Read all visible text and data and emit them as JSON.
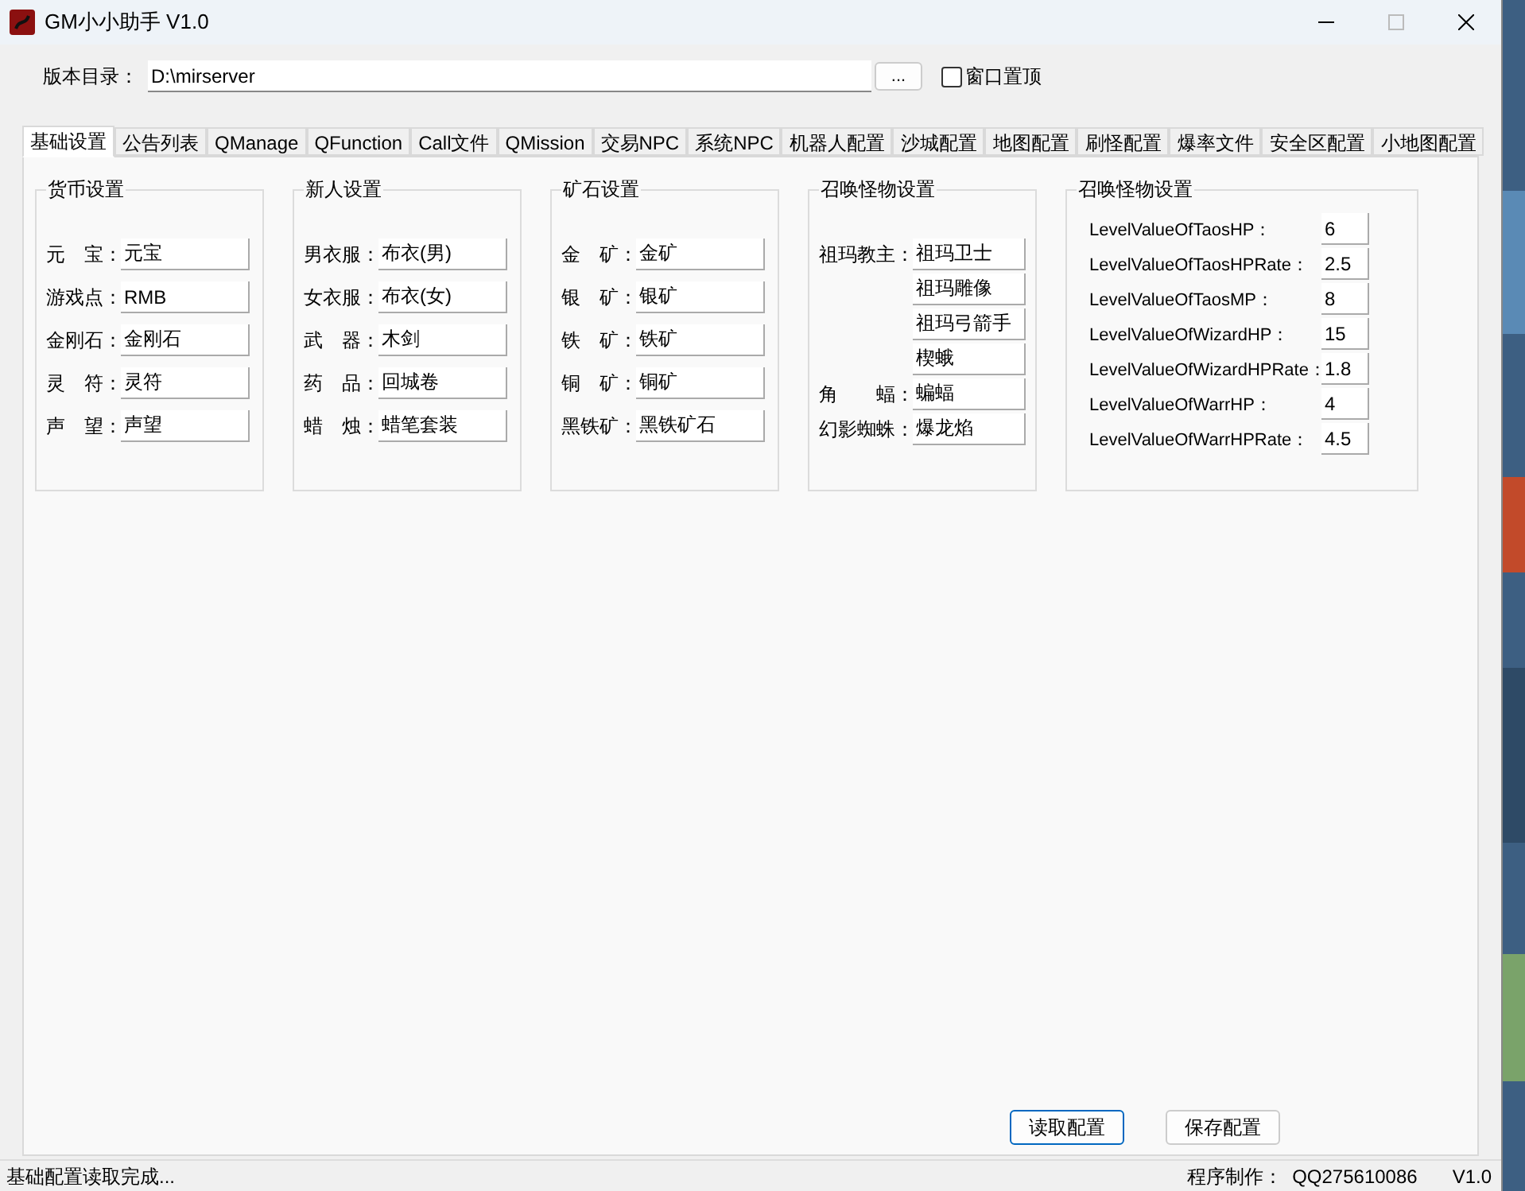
{
  "window": {
    "title": "GM小小助手 V1.0"
  },
  "version_dir": {
    "label": "版本目录：",
    "value": "D:\\mirserver",
    "browse": "...",
    "topmost": {
      "label": "窗口置顶",
      "checked": false
    }
  },
  "tabs": [
    {
      "label": "基础设置",
      "selected": true
    },
    {
      "label": "公告列表",
      "selected": false
    },
    {
      "label": "QManage",
      "selected": false
    },
    {
      "label": "QFunction",
      "selected": false
    },
    {
      "label": "Call文件",
      "selected": false
    },
    {
      "label": "QMission",
      "selected": false
    },
    {
      "label": "交易NPC",
      "selected": false
    },
    {
      "label": "系统NPC",
      "selected": false
    },
    {
      "label": "机器人配置",
      "selected": false
    },
    {
      "label": "沙城配置",
      "selected": false
    },
    {
      "label": "地图配置",
      "selected": false
    },
    {
      "label": "刷怪配置",
      "selected": false
    },
    {
      "label": "爆率文件",
      "selected": false
    },
    {
      "label": "安全区配置",
      "selected": false
    },
    {
      "label": "小地图配置",
      "selected": false
    }
  ],
  "groups": [
    {
      "title": "货币设置",
      "kind": "basic",
      "rows": [
        {
          "label": "元　宝：",
          "value": "元宝"
        },
        {
          "label": "游戏点：",
          "value": "RMB"
        },
        {
          "label": "金刚石：",
          "value": "金刚石"
        },
        {
          "label": "灵　符：",
          "value": "灵符"
        },
        {
          "label": "声　望：",
          "value": "声望"
        }
      ]
    },
    {
      "title": "新人设置",
      "kind": "basic",
      "rows": [
        {
          "label": "男衣服：",
          "value": "布衣(男)"
        },
        {
          "label": "女衣服：",
          "value": "布衣(女)"
        },
        {
          "label": "武　器：",
          "value": "木剑"
        },
        {
          "label": "药　品：",
          "value": "回城卷"
        },
        {
          "label": "蜡　烛：",
          "value": "蜡笔套装"
        }
      ]
    },
    {
      "title": "矿石设置",
      "kind": "basic",
      "rows": [
        {
          "label": "金　矿：",
          "value": "金矿"
        },
        {
          "label": "银　矿：",
          "value": "银矿"
        },
        {
          "label": "铁　矿：",
          "value": "铁矿"
        },
        {
          "label": "铜　矿：",
          "value": "铜矿"
        },
        {
          "label": "黑铁矿：",
          "value": "黑铁矿石"
        }
      ]
    },
    {
      "title": "召唤怪物设置",
      "kind": "summon",
      "rows": [
        {
          "label": "祖玛教主：",
          "value": "祖玛卫士"
        },
        {
          "value": "祖玛雕像"
        },
        {
          "value": "祖玛弓箭手"
        },
        {
          "value": "楔蛾"
        },
        {
          "label": "角　　蝠：",
          "value": "蝙蝠"
        },
        {
          "label": "幻影蜘蛛：",
          "value": "爆龙焰"
        }
      ]
    },
    {
      "title": "召唤怪物设置",
      "kind": "level",
      "rows": [
        {
          "label": "LevelValueOfTaosHP：",
          "value": "6"
        },
        {
          "label": "LevelValueOfTaosHPRate：",
          "value": "2.5"
        },
        {
          "label": "LevelValueOfTaosMP：",
          "value": "8"
        },
        {
          "label": "LevelValueOfWizardHP：",
          "value": "15"
        },
        {
          "label": "LevelValueOfWizardHPRate：",
          "value": "1.8"
        },
        {
          "label": "LevelValueOfWarrHP：",
          "value": "4"
        },
        {
          "label": "LevelValueOfWarrHPRate：",
          "value": "4.5"
        }
      ]
    }
  ],
  "buttons": [
    "读取配置",
    "保存配置"
  ],
  "status_bar": {
    "message": "基础配置读取完成...",
    "author_label": "程序制作：",
    "author": "QQ275610086",
    "version": "V1.0"
  }
}
